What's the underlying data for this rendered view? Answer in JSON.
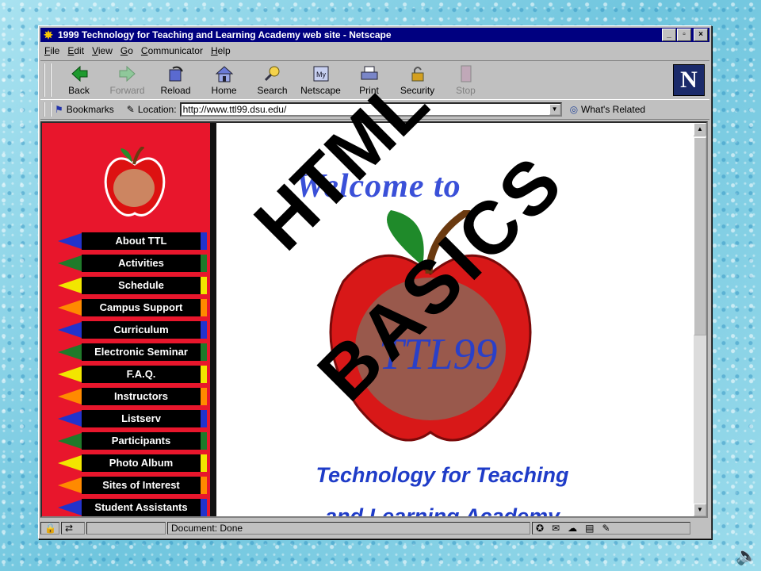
{
  "window": {
    "title": "1999 Technology for Teaching and Learning Academy web site - Netscape",
    "buttons": [
      "_",
      "▫",
      "×"
    ]
  },
  "menu": [
    "File",
    "Edit",
    "View",
    "Go",
    "Communicator",
    "Help"
  ],
  "toolbar": {
    "buttons": [
      {
        "label": "Back",
        "icon": "back-arrow-icon"
      },
      {
        "label": "Forward",
        "icon": "forward-arrow-icon",
        "disabled": true
      },
      {
        "label": "Reload",
        "icon": "reload-icon"
      },
      {
        "label": "Home",
        "icon": "home-icon"
      },
      {
        "label": "Search",
        "icon": "search-icon"
      },
      {
        "label": "Netscape",
        "icon": "my-netscape-icon"
      },
      {
        "label": "Print",
        "icon": "print-icon"
      },
      {
        "label": "Security",
        "icon": "security-lock-icon"
      },
      {
        "label": "Stop",
        "icon": "stop-icon",
        "disabled": true
      }
    ],
    "logo": "N"
  },
  "location": {
    "bookmarks_label": "Bookmarks",
    "location_label": "Location:",
    "url": "http://www.ttl99.dsu.edu/",
    "related_label": "What's Related"
  },
  "sidebar": {
    "items": [
      {
        "label": "About TTL",
        "color": "#2233cc"
      },
      {
        "label": "Activities",
        "color": "#1f7a2a"
      },
      {
        "label": "Schedule",
        "color": "#f2e600"
      },
      {
        "label": "Campus Support",
        "color": "#ff8a00"
      },
      {
        "label": "Curriculum",
        "color": "#2233cc"
      },
      {
        "label": "Electronic Seminar",
        "color": "#1f7a2a"
      },
      {
        "label": "F.A.Q.",
        "color": "#f2e600"
      },
      {
        "label": "Instructors",
        "color": "#ff8a00"
      },
      {
        "label": "Listserv",
        "color": "#2233cc"
      },
      {
        "label": "Participants",
        "color": "#1f7a2a"
      },
      {
        "label": "Photo Album",
        "color": "#f2e600"
      },
      {
        "label": "Sites of Interest",
        "color": "#ff8a00"
      },
      {
        "label": "Student Assistants",
        "color": "#2233cc"
      }
    ]
  },
  "main": {
    "welcome": "Welcome to",
    "logo_text": "TTL99",
    "tagline_line1": "Technology for Teaching",
    "tagline_line2": "and Learning Academy"
  },
  "overlay": {
    "line1": "HTML",
    "line2": "BASICS"
  },
  "status": {
    "text": "Document: Done"
  }
}
